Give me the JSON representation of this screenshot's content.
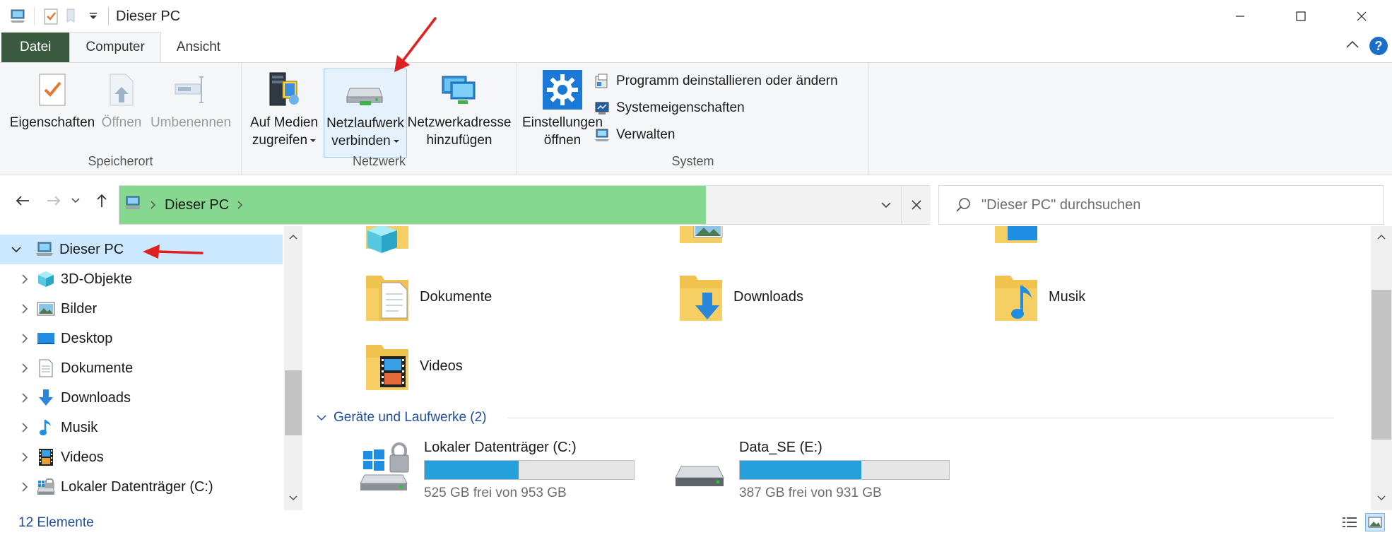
{
  "window": {
    "title": "Dieser PC"
  },
  "ribbon_tabs": [
    {
      "label": "Datei"
    },
    {
      "label": "Computer"
    },
    {
      "label": "Ansicht"
    }
  ],
  "ribbon": {
    "groups": {
      "location": {
        "label": "Speicherort",
        "properties": "Eigenschaften",
        "open": "Öffnen",
        "rename": "Umbenennen"
      },
      "network": {
        "label": "Netzwerk",
        "access_media_line1": "Auf Medien",
        "access_media_line2": "zugreifen",
        "map_drive_line1": "Netzlaufwerk",
        "map_drive_line2": "verbinden",
        "add_location_line1": "Netzwerkadresse",
        "add_location_line2": "hinzufügen"
      },
      "system": {
        "label": "System",
        "settings_line1": "Einstellungen",
        "settings_line2": "öffnen",
        "uninstall": "Programm deinstallieren oder ändern",
        "system_properties": "Systemeigenschaften",
        "manage": "Verwalten"
      }
    }
  },
  "address_bar": {
    "path_segment": "Dieser PC",
    "search_placeholder": "\"Dieser PC\" durchsuchen"
  },
  "nav_pane": {
    "items": [
      {
        "label": "Dieser PC",
        "icon": "this-pc-icon",
        "selected": true,
        "expanded": true
      },
      {
        "label": "3D-Objekte",
        "icon": "3d-objects-icon"
      },
      {
        "label": "Bilder",
        "icon": "pictures-icon"
      },
      {
        "label": "Desktop",
        "icon": "desktop-icon"
      },
      {
        "label": "Dokumente",
        "icon": "documents-icon"
      },
      {
        "label": "Downloads",
        "icon": "downloads-icon"
      },
      {
        "label": "Musik",
        "icon": "music-icon"
      },
      {
        "label": "Videos",
        "icon": "videos-icon"
      },
      {
        "label": "Lokaler Datenträger (C:)",
        "icon": "local-disk-icon"
      }
    ]
  },
  "content": {
    "folders": [
      {
        "label": "Dokumente",
        "icon": "documents-folder-icon"
      },
      {
        "label": "Downloads",
        "icon": "downloads-folder-icon"
      },
      {
        "label": "Musik",
        "icon": "music-folder-icon"
      },
      {
        "label": "Videos",
        "icon": "videos-folder-icon"
      }
    ],
    "devices_section": "Geräte und Laufwerke (2)",
    "drives": [
      {
        "name": "Lokaler Datenträger (C:)",
        "free_text": "525 GB frei von 953 GB",
        "used_fraction": 0.45
      },
      {
        "name": "Data_SE (E:)",
        "free_text": "387 GB frei von 931 GB",
        "used_fraction": 0.58
      }
    ]
  },
  "status_bar": {
    "item_count": "12 Elemente"
  },
  "colors": {
    "file_tab": "#3a5a40",
    "address_highlight": "#86d78f",
    "selection": "#cce8ff",
    "drive_bar": "#26a0da",
    "annotation_arrow": "#e02020",
    "link_blue": "#1e4e9a"
  }
}
